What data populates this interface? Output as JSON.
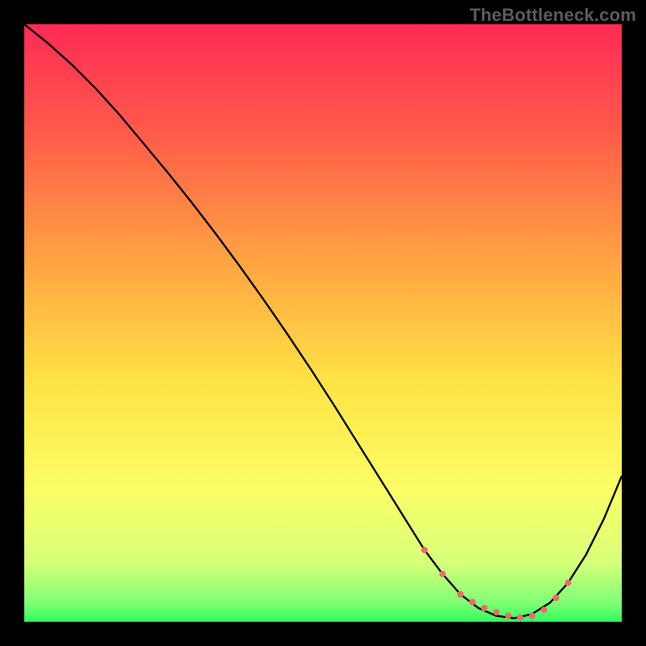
{
  "watermark": "TheBottleneck.com",
  "chart_data": {
    "type": "line",
    "title": "",
    "xlabel": "",
    "ylabel": "",
    "xlim": [
      0,
      100
    ],
    "ylim": [
      0,
      100
    ],
    "grid": false,
    "legend": false,
    "gradient_stops": [
      {
        "offset": 0,
        "color": "#ff2a55"
      },
      {
        "offset": 18,
        "color": "#ff5a4a"
      },
      {
        "offset": 40,
        "color": "#ffa542"
      },
      {
        "offset": 60,
        "color": "#ffe345"
      },
      {
        "offset": 78,
        "color": "#fbff66"
      },
      {
        "offset": 90,
        "color": "#d8ff7a"
      },
      {
        "offset": 97,
        "color": "#7dff74"
      },
      {
        "offset": 100,
        "color": "#2bff5e"
      }
    ],
    "series": [
      {
        "name": "curve",
        "color": "#000000",
        "x": [
          0,
          4,
          8,
          12,
          16,
          20,
          24,
          28,
          32,
          36,
          40,
          44,
          48,
          52,
          56,
          60,
          64,
          67,
          70,
          73,
          76,
          79,
          82,
          85,
          88,
          91,
          94,
          97,
          100
        ],
        "y": [
          100,
          96.8,
          93.2,
          89.2,
          84.8,
          80,
          75.2,
          70.2,
          65,
          59.6,
          54,
          48.2,
          42.2,
          36,
          29.6,
          23.2,
          16.8,
          12,
          8,
          4.6,
          2.3,
          1,
          0.6,
          1.3,
          3.2,
          6.5,
          11.2,
          17.2,
          24.4
        ]
      },
      {
        "name": "bottom-dots",
        "color": "#ef6a6a",
        "type": "scatter",
        "x": [
          67,
          70,
          73,
          75,
          77,
          79,
          81,
          83,
          85,
          87,
          89,
          91
        ],
        "y": [
          12,
          8,
          4.6,
          3.3,
          2.3,
          1.6,
          1.0,
          0.7,
          1.0,
          2.0,
          4.0,
          6.5
        ],
        "marker_size": 8
      }
    ]
  }
}
